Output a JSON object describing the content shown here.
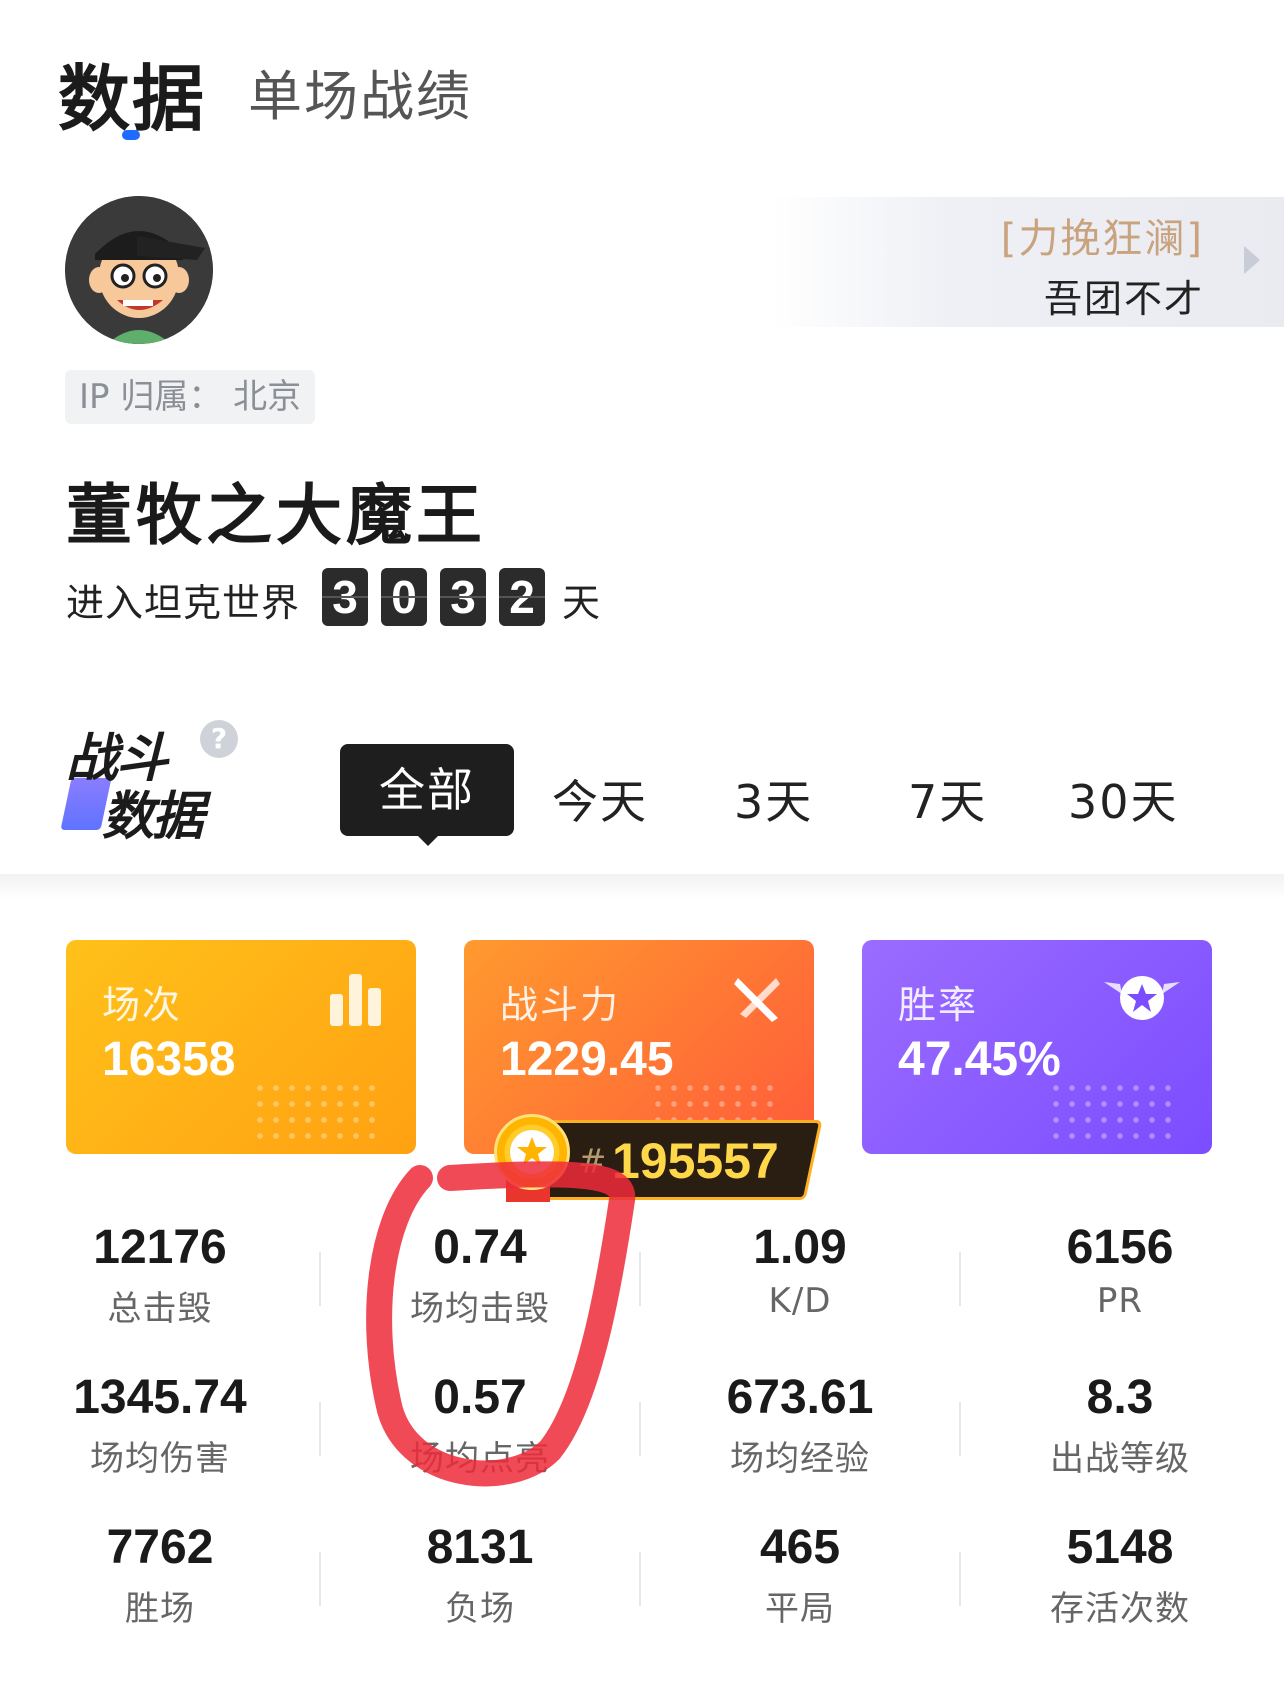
{
  "tabs": {
    "active": "数据",
    "other": "单场战绩"
  },
  "title_badge": {
    "tag": "[力挽狂澜]",
    "name": "吾团不才"
  },
  "profile": {
    "ip": "IP 归属： 北京",
    "name": "董牧之大魔王",
    "days_prefix": "进入坦克世界",
    "days_digits": [
      "3",
      "0",
      "3",
      "2"
    ],
    "days_suffix": "天"
  },
  "combat": {
    "heading_line1": "战斗",
    "heading_line2": "数据",
    "help": "?",
    "periods": [
      "全部",
      "今天",
      "3天",
      "7天",
      "30天"
    ],
    "active_period": "全部"
  },
  "cards": [
    {
      "label": "场次",
      "value": "16358",
      "icon": "bar-chart-icon",
      "color": "#ffb11a"
    },
    {
      "label": "战斗力",
      "value": "1229.45",
      "icon": "crossed-swords-icon",
      "color": "#ff6d35"
    },
    {
      "label": "胜率",
      "value": "47.45%",
      "icon": "star-badge-icon",
      "color": "#8a5cff"
    }
  ],
  "rank": {
    "hash": "#",
    "value": "195557"
  },
  "stats": [
    [
      {
        "value": "12176",
        "label": "总击毁"
      },
      {
        "value": "0.74",
        "label": "场均击毁"
      },
      {
        "value": "1.09",
        "label": "K/D"
      },
      {
        "value": "6156",
        "label": "PR"
      }
    ],
    [
      {
        "value": "1345.74",
        "label": "场均伤害"
      },
      {
        "value": "0.57",
        "label": "场均点亮"
      },
      {
        "value": "673.61",
        "label": "场均经验"
      },
      {
        "value": "8.3",
        "label": "出战等级"
      }
    ],
    [
      {
        "value": "7762",
        "label": "胜场"
      },
      {
        "value": "8131",
        "label": "负场"
      },
      {
        "value": "465",
        "label": "平局"
      },
      {
        "value": "5148",
        "label": "存活次数"
      }
    ]
  ]
}
